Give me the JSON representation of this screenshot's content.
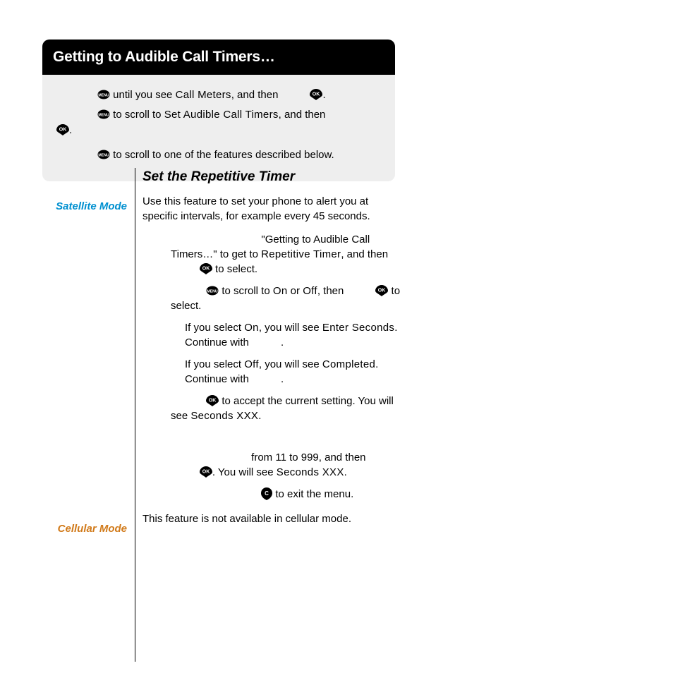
{
  "card": {
    "title": "Getting to Audible Call Timers…",
    "line1a": " until you see ",
    "line1b": "Call Meters",
    "line1c": ", and then ",
    "line1d": ".",
    "line2a": " to scroll to ",
    "line2b": "Set Audible Call Timers",
    "line2c": ", and then ",
    "line2d": ".",
    "line3": " to scroll to one of the features described below."
  },
  "modes": {
    "satellite": "Satellite Mode",
    "cellular": "Cellular Mode"
  },
  "section": {
    "title": "Set the Repetitive Timer",
    "intro": "Use this feature to set your phone to alert you at specific intervals, for example every 45 seconds.",
    "s1a": "\"Getting to Audible Call Timers…\" to get to ",
    "s1b": "Repetitive Timer",
    "s1c": ", and then ",
    "s1d": " to select.",
    "s2a": " to scroll to ",
    "s2b": "On",
    "s2c": " or ",
    "s2d": "Off",
    "s2e": ", then ",
    "s2f": " to select.",
    "s2if_on_a": "If you select ",
    "s2if_on_b": "On",
    "s2if_on_c": ", you will see ",
    "s2if_on_d": "Enter Seconds",
    "s2if_on_e": ". Continue with ",
    "s2if_on_f": ".",
    "s2if_off_a": "If you select ",
    "s2if_off_b": "Off",
    "s2if_off_c": ", you will see ",
    "s2if_off_d": "Completed",
    "s2if_off_e": ". Continue with ",
    "s2if_off_f": ".",
    "s3a": " to accept the current setting. You will see ",
    "s3b": "Seconds XXX",
    "s3c": ".",
    "s4a": " from 11 to 999, and then ",
    "s4b": ". You will see ",
    "s4c": "Seconds XXX",
    "s4d": ".",
    "s5a": " to exit the menu.",
    "cellular_text": "This feature is not available in cellular mode."
  }
}
